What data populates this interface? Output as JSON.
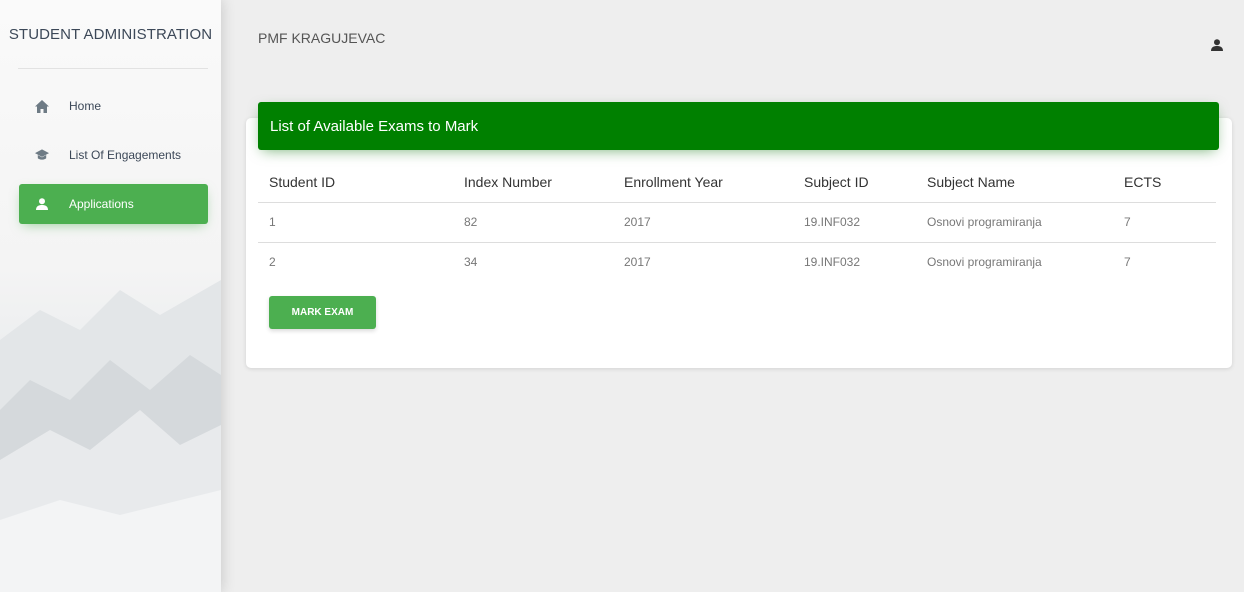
{
  "sidebar": {
    "brand": "STUDENT ADMINISTRATION",
    "items": [
      {
        "label": "Home",
        "icon": "home-icon"
      },
      {
        "label": "List Of Engagements",
        "icon": "graduation-cap-icon"
      },
      {
        "label": "Applications",
        "icon": "person-icon",
        "active": true
      }
    ]
  },
  "topbar": {
    "title": "PMF KRAGUJEVAC",
    "user_icon": "person-icon"
  },
  "card": {
    "header": "List of Available Exams to Mark",
    "columns": [
      "Student ID",
      "Index Number",
      "Enrollment Year",
      "Subject ID",
      "Subject Name",
      "ECTS"
    ],
    "rows": [
      [
        "1",
        "82",
        "2017",
        "19.INF032",
        "Osnovi programiranja",
        "7"
      ],
      [
        "2",
        "34",
        "2017",
        "19.INF032",
        "Osnovi programiranja",
        "7"
      ]
    ],
    "button_label": "MARK EXAM"
  },
  "colors": {
    "accent": "#4caf50",
    "header": "#008000",
    "background": "#eeeeee"
  }
}
